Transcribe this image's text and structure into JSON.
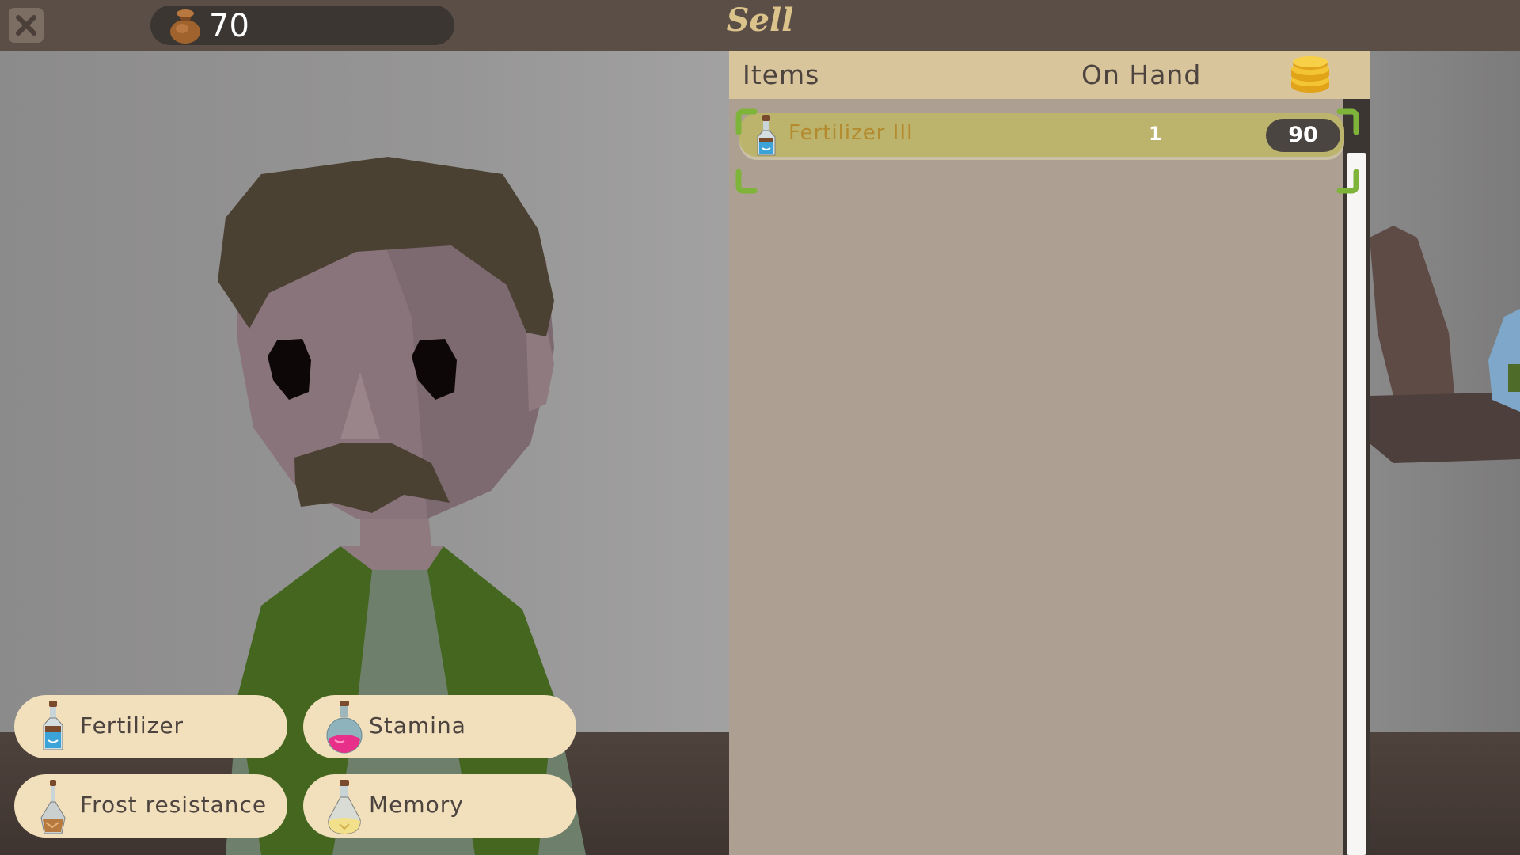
{
  "header": {
    "title": "Sell",
    "money": "70",
    "close_icon": "close-x-icon",
    "money_icon": "money-bag-icon"
  },
  "panel": {
    "columns": {
      "items": "Items",
      "on_hand": "On Hand",
      "price_icon": "gold-coins-icon"
    },
    "rows": [
      {
        "name": "Fertilizer III",
        "on_hand": "1",
        "price": "90",
        "icon": "blue-potion-bottle-icon",
        "selected": true
      }
    ]
  },
  "categories": [
    {
      "label": "Fertilizer",
      "icon": "fertilizer-bottle-icon"
    },
    {
      "label": "Stamina",
      "icon": "stamina-flask-icon"
    },
    {
      "label": "Frost resistance",
      "icon": "frost-bottle-icon"
    },
    {
      "label": "Memory",
      "icon": "memory-flask-icon"
    }
  ],
  "colors": {
    "topbar": "#5a4e46",
    "panel_header": "#d9c59b",
    "panel_body": "#ad9f91",
    "selected_row": "#bcb46c",
    "selection_bracket": "#7fb43a",
    "category_button": "#f2e0bd",
    "title": "#dcc38c"
  }
}
